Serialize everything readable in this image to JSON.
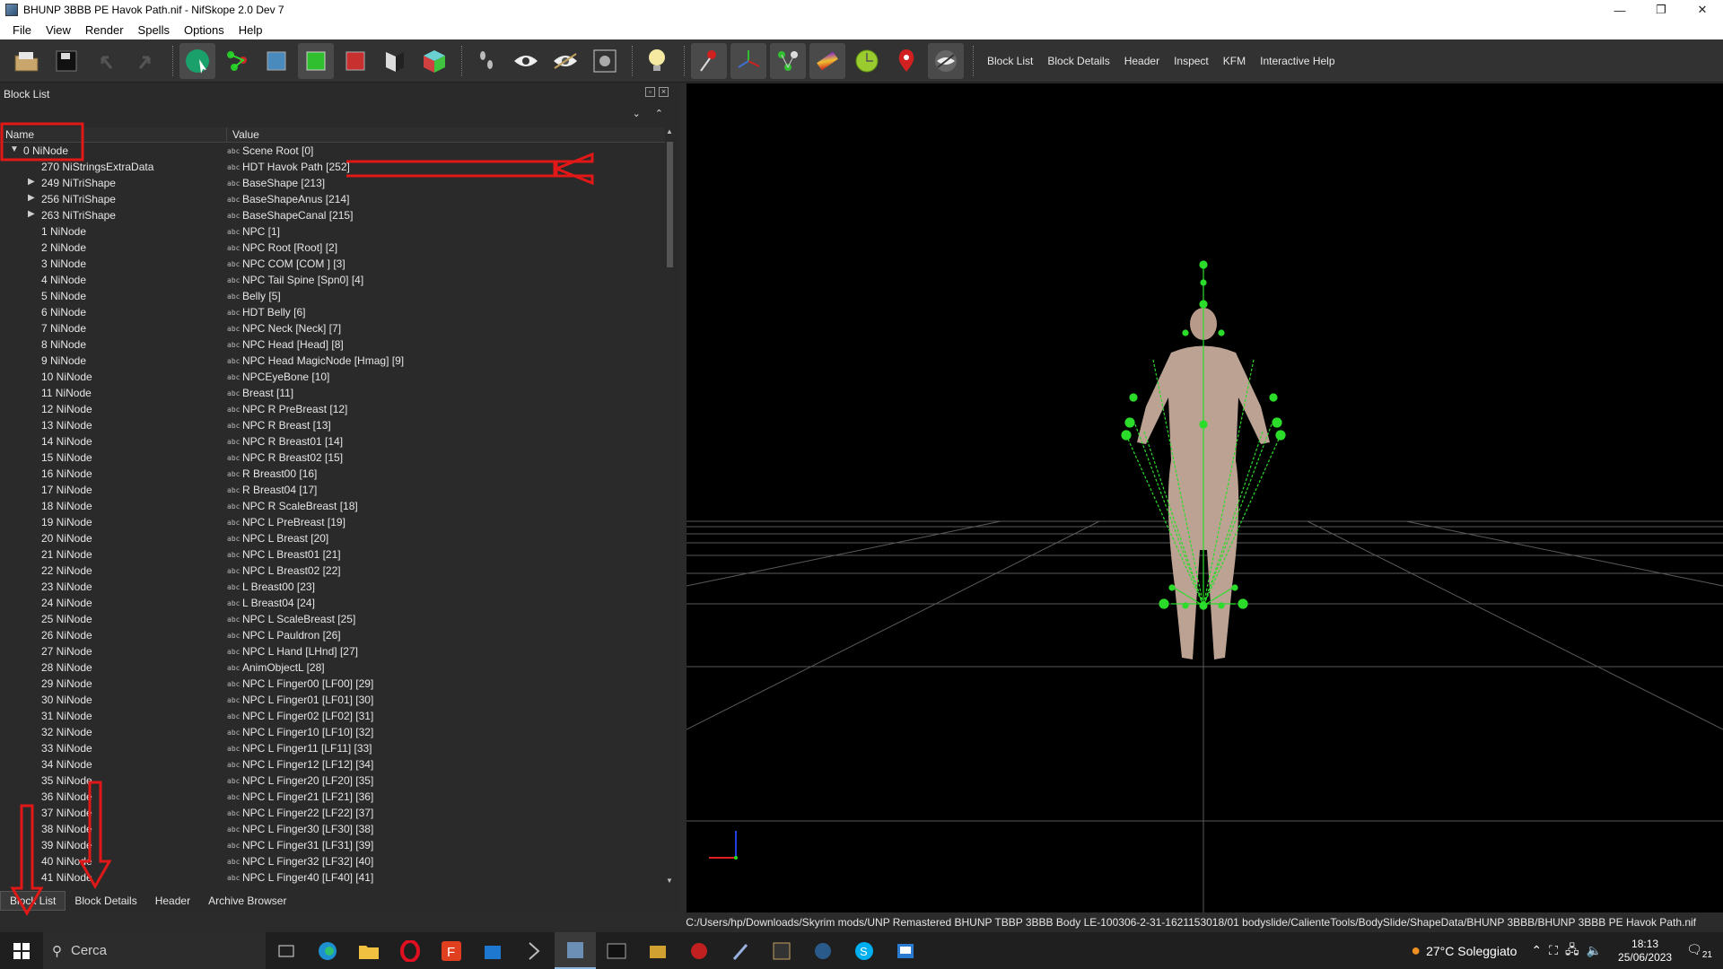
{
  "window": {
    "title": "BHUNP 3BBB PE Havok Path.nif - NifSkope 2.0 Dev 7",
    "minimize": "—",
    "restore": "❐",
    "close": "✕"
  },
  "menu": [
    "File",
    "View",
    "Render",
    "Spells",
    "Options",
    "Help"
  ],
  "toolbar": {
    "icons": [
      "open-icon",
      "save-icon",
      "undo-icon",
      "redo-icon",
      "select-mode-icon",
      "skeleton-icon",
      "cube-shaded-icon",
      "cube-green-icon",
      "cube-red-icon",
      "half-cube-icon",
      "color-cube-icon",
      "footprints-icon",
      "eye-icon",
      "eye-hidden-icon",
      "camera-icon",
      "lightbulb-icon",
      "pin-tool-icon",
      "axes-icon",
      "nodes-icon",
      "gradient-icon",
      "circle-icon",
      "location-pin-icon",
      "hidden-eye-icon"
    ],
    "dock_toggles": [
      "Block List",
      "Block Details",
      "Header",
      "Inspect",
      "KFM",
      "Interactive Help"
    ]
  },
  "block_list": {
    "title": "Block List",
    "columns": {
      "name": "Name",
      "value": "Value"
    },
    "rows": [
      {
        "name": "0 NiNode",
        "value": "Scene Root [0]",
        "level": 0,
        "expand": "open"
      },
      {
        "name": "270 NiStringsExtraData",
        "value": "HDT Havok Path [252]",
        "level": 1,
        "expand": ""
      },
      {
        "name": "249 NiTriShape",
        "value": "BaseShape [213]",
        "level": 1,
        "expand": "closed"
      },
      {
        "name": "256 NiTriShape",
        "value": "BaseShapeAnus [214]",
        "level": 1,
        "expand": "closed"
      },
      {
        "name": "263 NiTriShape",
        "value": "BaseShapeCanal [215]",
        "level": 1,
        "expand": "closed"
      },
      {
        "name": "1 NiNode",
        "value": "NPC [1]",
        "level": 1,
        "expand": ""
      },
      {
        "name": "2 NiNode",
        "value": "NPC Root [Root] [2]",
        "level": 1,
        "expand": ""
      },
      {
        "name": "3 NiNode",
        "value": "NPC COM [COM ] [3]",
        "level": 1,
        "expand": ""
      },
      {
        "name": "4 NiNode",
        "value": "NPC Tail Spine [Spn0] [4]",
        "level": 1,
        "expand": ""
      },
      {
        "name": "5 NiNode",
        "value": "Belly [5]",
        "level": 1,
        "expand": ""
      },
      {
        "name": "6 NiNode",
        "value": "HDT Belly [6]",
        "level": 1,
        "expand": ""
      },
      {
        "name": "7 NiNode",
        "value": "NPC Neck [Neck] [7]",
        "level": 1,
        "expand": ""
      },
      {
        "name": "8 NiNode",
        "value": "NPC Head [Head] [8]",
        "level": 1,
        "expand": ""
      },
      {
        "name": "9 NiNode",
        "value": "NPC Head MagicNode [Hmag] [9]",
        "level": 1,
        "expand": ""
      },
      {
        "name": "10 NiNode",
        "value": "NPCEyeBone [10]",
        "level": 1,
        "expand": ""
      },
      {
        "name": "11 NiNode",
        "value": "Breast [11]",
        "level": 1,
        "expand": ""
      },
      {
        "name": "12 NiNode",
        "value": "NPC R PreBreast [12]",
        "level": 1,
        "expand": ""
      },
      {
        "name": "13 NiNode",
        "value": "NPC R Breast [13]",
        "level": 1,
        "expand": ""
      },
      {
        "name": "14 NiNode",
        "value": "NPC R Breast01 [14]",
        "level": 1,
        "expand": ""
      },
      {
        "name": "15 NiNode",
        "value": "NPC R Breast02 [15]",
        "level": 1,
        "expand": ""
      },
      {
        "name": "16 NiNode",
        "value": "R Breast00 [16]",
        "level": 1,
        "expand": ""
      },
      {
        "name": "17 NiNode",
        "value": "R Breast04 [17]",
        "level": 1,
        "expand": ""
      },
      {
        "name": "18 NiNode",
        "value": "NPC R ScaleBreast [18]",
        "level": 1,
        "expand": ""
      },
      {
        "name": "19 NiNode",
        "value": "NPC L PreBreast [19]",
        "level": 1,
        "expand": ""
      },
      {
        "name": "20 NiNode",
        "value": "NPC L Breast [20]",
        "level": 1,
        "expand": ""
      },
      {
        "name": "21 NiNode",
        "value": "NPC L Breast01 [21]",
        "level": 1,
        "expand": ""
      },
      {
        "name": "22 NiNode",
        "value": "NPC L Breast02 [22]",
        "level": 1,
        "expand": ""
      },
      {
        "name": "23 NiNode",
        "value": "L Breast00 [23]",
        "level": 1,
        "expand": ""
      },
      {
        "name": "24 NiNode",
        "value": "L Breast04 [24]",
        "level": 1,
        "expand": ""
      },
      {
        "name": "25 NiNode",
        "value": "NPC L ScaleBreast [25]",
        "level": 1,
        "expand": ""
      },
      {
        "name": "26 NiNode",
        "value": "NPC L Pauldron [26]",
        "level": 1,
        "expand": ""
      },
      {
        "name": "27 NiNode",
        "value": "NPC L Hand [LHnd] [27]",
        "level": 1,
        "expand": ""
      },
      {
        "name": "28 NiNode",
        "value": "AnimObjectL [28]",
        "level": 1,
        "expand": ""
      },
      {
        "name": "29 NiNode",
        "value": "NPC L Finger00 [LF00] [29]",
        "level": 1,
        "expand": ""
      },
      {
        "name": "30 NiNode",
        "value": "NPC L Finger01 [LF01] [30]",
        "level": 1,
        "expand": ""
      },
      {
        "name": "31 NiNode",
        "value": "NPC L Finger02 [LF02] [31]",
        "level": 1,
        "expand": ""
      },
      {
        "name": "32 NiNode",
        "value": "NPC L Finger10 [LF10] [32]",
        "level": 1,
        "expand": ""
      },
      {
        "name": "33 NiNode",
        "value": "NPC L Finger11 [LF11] [33]",
        "level": 1,
        "expand": ""
      },
      {
        "name": "34 NiNode",
        "value": "NPC L Finger12 [LF12] [34]",
        "level": 1,
        "expand": ""
      },
      {
        "name": "35 NiNode",
        "value": "NPC L Finger20 [LF20] [35]",
        "level": 1,
        "expand": ""
      },
      {
        "name": "36 NiNode",
        "value": "NPC L Finger21 [LF21] [36]",
        "level": 1,
        "expand": ""
      },
      {
        "name": "37 NiNode",
        "value": "NPC L Finger22 [LF22] [37]",
        "level": 1,
        "expand": ""
      },
      {
        "name": "38 NiNode",
        "value": "NPC L Finger30 [LF30] [38]",
        "level": 1,
        "expand": ""
      },
      {
        "name": "39 NiNode",
        "value": "NPC L Finger31 [LF31] [39]",
        "level": 1,
        "expand": ""
      },
      {
        "name": "40 NiNode",
        "value": "NPC L Finger32 [LF32] [40]",
        "level": 1,
        "expand": ""
      },
      {
        "name": "41 NiNode",
        "value": "NPC L Finger40 [LF40] [41]",
        "level": 1,
        "expand": ""
      }
    ]
  },
  "bottom_tabs": [
    "Block List",
    "Block Details",
    "Header",
    "Archive Browser"
  ],
  "status": {
    "path": "C:/Users/hp/Downloads/Skyrim mods/UNP Remastered BHUNP TBBP 3BBB Body LE-100306-2-31-1621153018/01 bodyslide/CalienteTools/BodySlide/ShapeData/BHUNP 3BBB/BHUNP 3BBB PE Havok Path.nif"
  },
  "taskbar": {
    "search_placeholder": "Cerca",
    "weather": "27°C  Soleggiato",
    "time": "18:13",
    "date": "25/06/2023",
    "notifications": "21"
  },
  "colors": {
    "annotation": "#e01818",
    "bone": "#2bdc2b",
    "background": "#2b2b2b",
    "viewport": "#000000"
  }
}
